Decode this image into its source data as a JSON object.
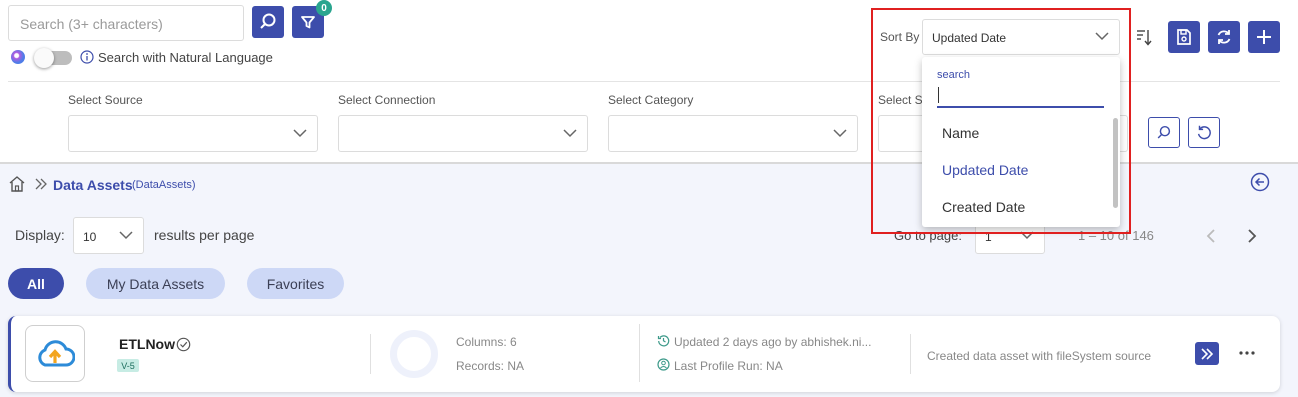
{
  "search": {
    "placeholder": "Search (3+ characters)",
    "filter_badge": "0",
    "nl_label": "Search with Natural Language"
  },
  "sort": {
    "label": "Sort By",
    "selected": "Updated Date",
    "dropdown": {
      "search_label": "search",
      "options": [
        "Name",
        "Updated Date",
        "Created Date"
      ],
      "active_index": 1
    }
  },
  "filters": [
    {
      "label": "Select Source"
    },
    {
      "label": "Select Connection"
    },
    {
      "label": "Select Category"
    },
    {
      "label": "Select St"
    }
  ],
  "breadcrumb": {
    "title": "Data Assets",
    "subtitle": "(DataAssets)"
  },
  "pagination": {
    "display_label": "Display:",
    "per_page": "10",
    "per_page_suffix": "results per page",
    "goto_label": "Go to page:",
    "page": "1",
    "range": "1 – 10 of 146"
  },
  "tabs": [
    {
      "label": "All",
      "active": true
    },
    {
      "label": "My Data Assets"
    },
    {
      "label": "Favorites"
    }
  ],
  "asset": {
    "name": "ETLNow",
    "version": "V-5",
    "columns": "Columns: 6",
    "records": "Records: NA",
    "updated": "Updated 2 days ago by abhishek.ni...",
    "last_profile": "Last Profile Run: NA",
    "description": "Created data asset with fileSystem source"
  },
  "colors": {
    "accent": "#3d4dab",
    "highlight": "#e02020",
    "pill_inactive": "#cdd8f6",
    "link": "#3d4dab"
  }
}
